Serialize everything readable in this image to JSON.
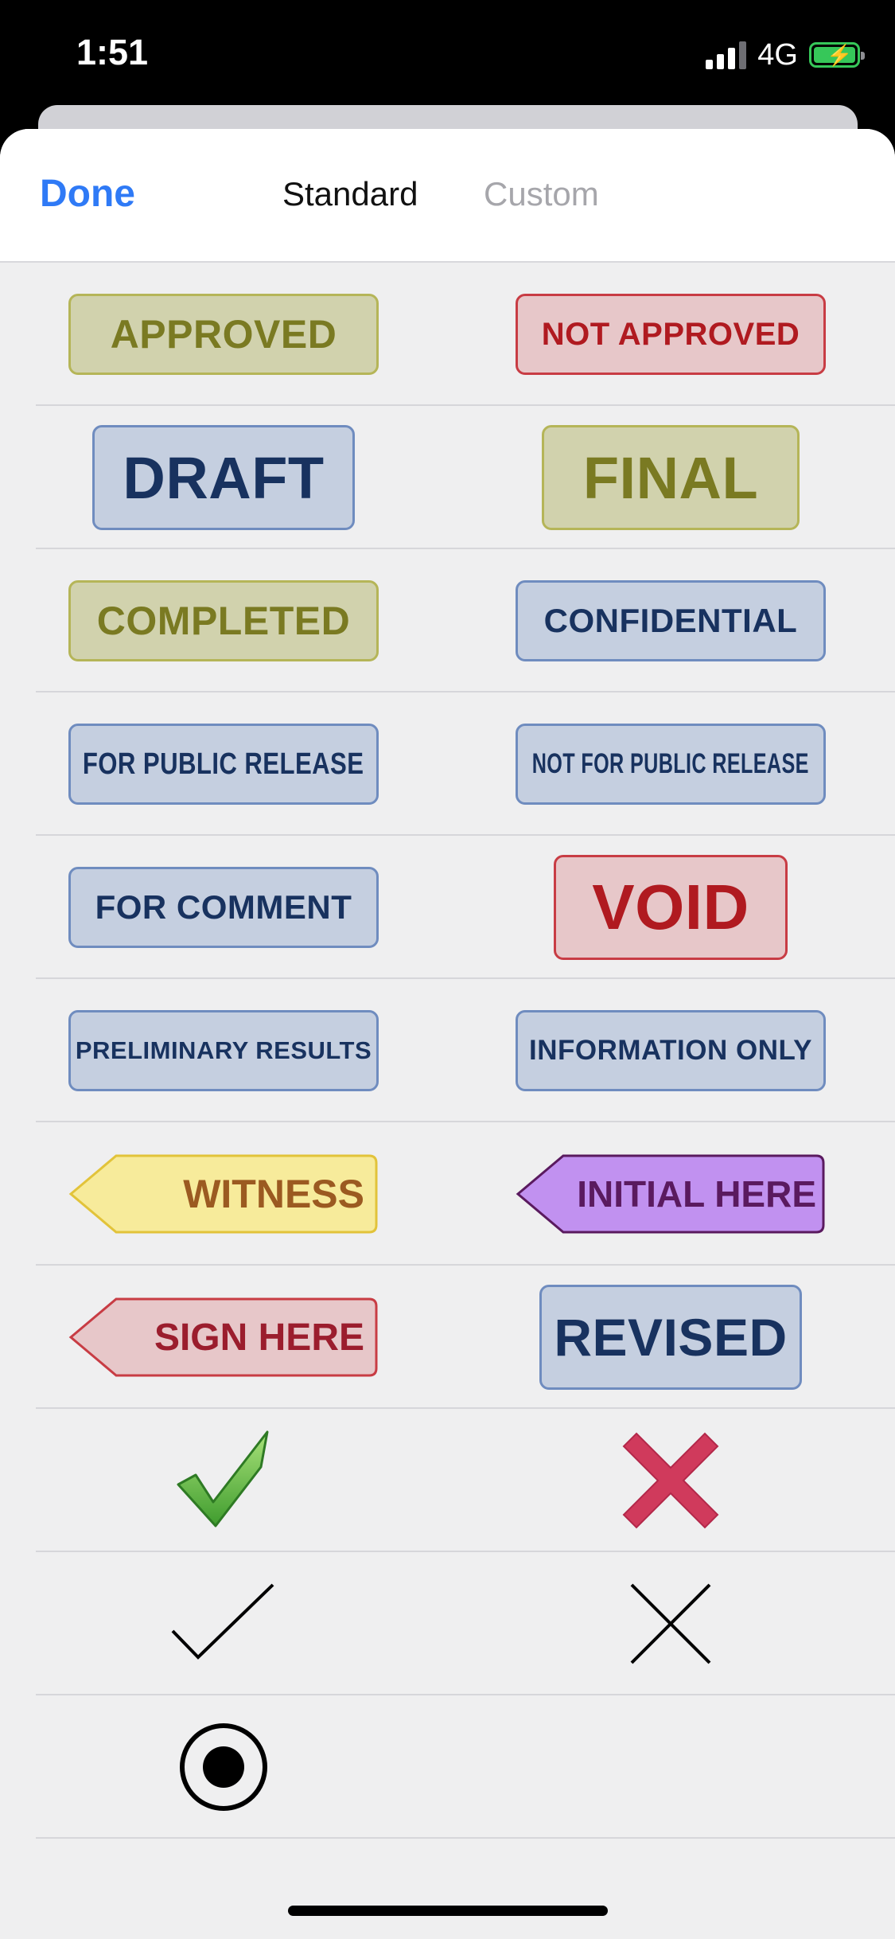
{
  "status_bar": {
    "time": "1:51",
    "network": "4G"
  },
  "header": {
    "done_label": "Done",
    "tabs": [
      "Standard",
      "Custom"
    ],
    "active_tab": "Standard"
  },
  "stamps": {
    "approved": "APPROVED",
    "not_approved": "NOT APPROVED",
    "draft": "DRAFT",
    "final": "FINAL",
    "completed": "COMPLETED",
    "confidential": "CONFIDENTIAL",
    "for_public_release": "FOR PUBLIC RELEASE",
    "not_for_public_release": "NOT FOR PUBLIC RELEASE",
    "for_comment": "FOR COMMENT",
    "void": "VOID",
    "preliminary_results": "PRELIMINARY RESULTS",
    "information_only": "INFORMATION ONLY",
    "witness": "WITNESS",
    "initial_here": "INITIAL HERE",
    "sign_here": "SIGN HERE",
    "revised": "REVISED"
  },
  "symbols": [
    "green-checkmark-icon",
    "red-x-icon",
    "black-checkmark-icon",
    "black-x-icon",
    "circle-dot-icon"
  ],
  "colors": {
    "accent": "#2f7af6",
    "green_stamp_bg": "#d1d2ad",
    "green_stamp_text": "#7a7a22",
    "red_stamp_bg": "#e7c7c9",
    "red_stamp_text": "#b01a20",
    "blue_stamp_bg": "#c5cfe0",
    "blue_stamp_text": "#18325f",
    "witness_bg": "#f7eb9b",
    "witness_text": "#9b5a21",
    "initial_here_bg": "#c191f0",
    "initial_here_text": "#5a1a5f"
  }
}
